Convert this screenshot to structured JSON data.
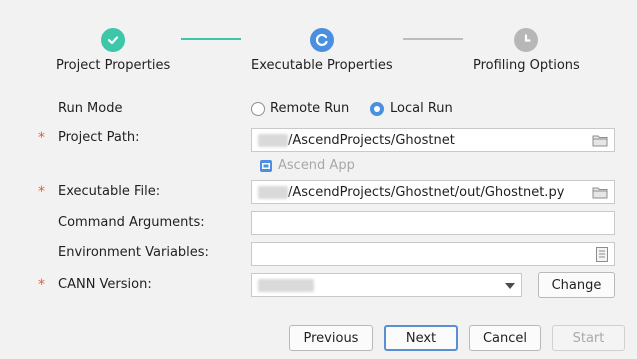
{
  "steps": [
    {
      "label": "Project Properties",
      "state": "done"
    },
    {
      "label": "Executable Properties",
      "state": "active"
    },
    {
      "label": "Profiling Options",
      "state": "pending"
    }
  ],
  "run_mode": {
    "label": "Run Mode",
    "options": [
      "Remote Run",
      "Local Run"
    ],
    "selected": "Local Run"
  },
  "project_path": {
    "label": "Project Path:",
    "value": "/AscendProjects/Ghostnet"
  },
  "ascend_app": {
    "label": "Ascend App"
  },
  "executable_file": {
    "label": "Executable File:",
    "value": "/AscendProjects/Ghostnet/out/Ghostnet.py"
  },
  "command_arguments": {
    "label": "Command Arguments:",
    "value": ""
  },
  "environment_variables": {
    "label": "Environment Variables:",
    "value": ""
  },
  "cann_version": {
    "label": "CANN Version:",
    "change_label": "Change"
  },
  "required_mark": "*",
  "buttons": {
    "previous": "Previous",
    "next": "Next",
    "cancel": "Cancel",
    "start": "Start"
  },
  "colors": {
    "done": "#3ec6a8",
    "active": "#4a8fe0",
    "pending": "#b7b7b7",
    "required": "#e0603a"
  }
}
